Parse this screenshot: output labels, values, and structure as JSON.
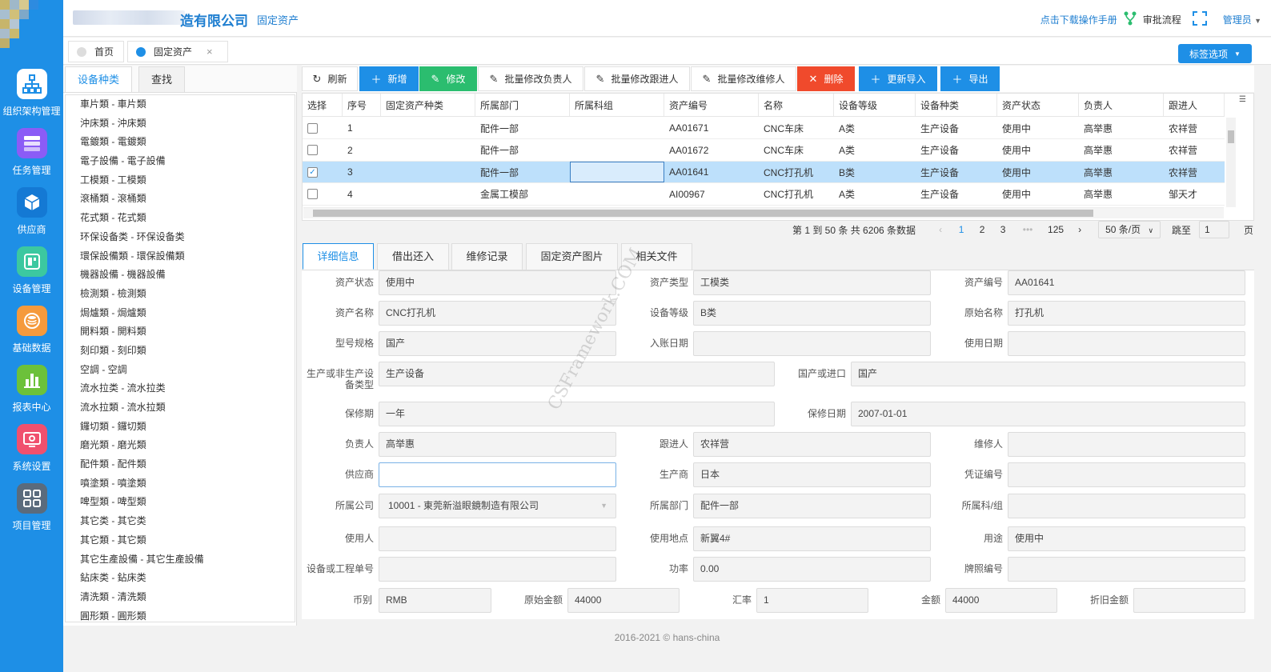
{
  "header": {
    "company_name": "造有限公司",
    "module": "固定资产",
    "manual_link": "点击下载操作手册",
    "approval_flow": "审批流程",
    "user": "管理员"
  },
  "sidebar": {
    "items": [
      {
        "label": "组织架构管理",
        "icon": "org-chart-icon",
        "color": "#1e8fe6"
      },
      {
        "label": "任务管理",
        "icon": "task-list-icon",
        "color": "#8b5cf6"
      },
      {
        "label": "供应商",
        "icon": "cube-icon",
        "color": "#1479d4"
      },
      {
        "label": "设备管理",
        "icon": "device-icon",
        "color": "#3cc8a0"
      },
      {
        "label": "基础数据",
        "icon": "database-icon",
        "color": "#f59a3c"
      },
      {
        "label": "报表中心",
        "icon": "bar-chart-icon",
        "color": "#6cc13a"
      },
      {
        "label": "系统设置",
        "icon": "settings-icon",
        "color": "#f0506e"
      },
      {
        "label": "项目管理",
        "icon": "grid-apps-icon",
        "color": "#5a6b7d"
      }
    ]
  },
  "page_tabs": [
    {
      "label": "首页"
    },
    {
      "label": "固定资产"
    }
  ],
  "tag_options": "标签选项",
  "category_panel": {
    "tab_category": "设备种类",
    "tab_search": "查找",
    "items": [
      "車片類 - 車片類",
      "沖床類 - 沖床類",
      "電鍍類 - 電鍍類",
      "電子設備 - 電子設備",
      "工模類 - 工模類",
      "滾桶類 - 滾桶類",
      "花式類 - 花式類",
      "环保设备类 - 环保设备类",
      "環保設備類 - 環保設備類",
      "機器設備 - 機器設備",
      "檢測類 - 檢測類",
      "焗爐類 - 焗爐類",
      "開料類 - 開料類",
      "刻印類 - 刻印類",
      "空調 - 空調",
      "流水拉类 - 流水拉类",
      "流水拉類 - 流水拉類",
      "鑼切類 - 鑼切類",
      "磨光類 - 磨光類",
      "配件類 - 配件類",
      "噴塗類 - 噴塗類",
      "啤型類 - 啤型類",
      "其它类 - 其它类",
      "其它類 - 其它類",
      "其它生產設備 - 其它生產設備",
      "鉆床类 - 鉆床类",
      "清洗類 - 清洗類",
      "圓形類 - 圓形類"
    ]
  },
  "toolbar": {
    "refresh": "刷新",
    "add": "新增",
    "edit": "修改",
    "batch_owner": "批量修改负责人",
    "batch_follower": "批量修改跟进人",
    "batch_maintainer": "批量修改维修人",
    "delete": "删除",
    "update_import": "更新导入",
    "export": "导出"
  },
  "grid": {
    "columns": [
      "选择",
      "序号",
      "固定资产种类",
      "所属部门",
      "所属科组",
      "资产编号",
      "名称",
      "设备等级",
      "设备种类",
      "资产状态",
      "负责人",
      "跟进人"
    ],
    "rows": [
      {
        "checked": false,
        "cells": [
          "1",
          "",
          "配件一部",
          "",
          "AA01671",
          "CNC车床",
          "A类",
          "生产设备",
          "使用中",
          "高举惠",
          "农祥营"
        ]
      },
      {
        "checked": false,
        "cells": [
          "2",
          "",
          "配件一部",
          "",
          "AA01672",
          "CNC车床",
          "A类",
          "生产设备",
          "使用中",
          "高举惠",
          "农祥营"
        ]
      },
      {
        "checked": true,
        "cells": [
          "3",
          "",
          "配件一部",
          "",
          "AA01641",
          "CNC打孔机",
          "B类",
          "生产设备",
          "使用中",
          "高举惠",
          "农祥营"
        ]
      },
      {
        "checked": false,
        "cells": [
          "4",
          "",
          "金属工模部",
          "",
          "AI00967",
          "CNC打孔机",
          "A类",
          "生产设备",
          "使用中",
          "高举惠",
          "邹天才"
        ]
      }
    ]
  },
  "pager": {
    "summary": "第 1 到 50 条 共 6206 条数据",
    "pages": [
      "1",
      "2",
      "3",
      "•••",
      "125"
    ],
    "page_size": "50 条/页",
    "goto_label": "跳至",
    "goto_value": "1",
    "page_unit": "页"
  },
  "detail_tabs": [
    "详细信息",
    "借出还入",
    "维修记录",
    "固定资产图片",
    "相关文件"
  ],
  "form": {
    "asset_status": {
      "label": "资产状态",
      "value": "使用中"
    },
    "asset_type": {
      "label": "资产类型",
      "value": "工模类"
    },
    "asset_no": {
      "label": "资产编号",
      "value": "AA01641"
    },
    "asset_name": {
      "label": "资产名称",
      "value": "CNC打孔机"
    },
    "equip_level": {
      "label": "设备等级",
      "value": "B类"
    },
    "orig_name": {
      "label": "原始名称",
      "value": "打孔机"
    },
    "model_spec": {
      "label": "型号规格",
      "value": "国产"
    },
    "entry_date": {
      "label": "入账日期",
      "value": ""
    },
    "use_date": {
      "label": "使用日期",
      "value": ""
    },
    "prod_type": {
      "label": "生产或非生产设备类型",
      "value": "生产设备"
    },
    "origin": {
      "label": "国产或进口",
      "value": "国产"
    },
    "warranty": {
      "label": "保修期",
      "value": "一年"
    },
    "warranty_date": {
      "label": "保修日期",
      "value": "2007-01-01"
    },
    "owner": {
      "label": "负责人",
      "value": "高举惠"
    },
    "follower": {
      "label": "跟进人",
      "value": "农祥营"
    },
    "maintainer": {
      "label": "维修人",
      "value": ""
    },
    "supplier": {
      "label": "供应商",
      "value": ""
    },
    "manufacturer": {
      "label": "生产商",
      "value": "日本"
    },
    "voucher_no": {
      "label": "凭证编号",
      "value": ""
    },
    "company": {
      "label": "所属公司",
      "value": "10001 - 東莞新溢眼鏡制造有限公司"
    },
    "department": {
      "label": "所属部门",
      "value": "配件一部"
    },
    "section": {
      "label": "所属科/组",
      "value": ""
    },
    "user": {
      "label": "使用人",
      "value": ""
    },
    "location": {
      "label": "使用地点",
      "value": "新翼4#"
    },
    "purpose": {
      "label": "用途",
      "value": "使用中"
    },
    "work_order": {
      "label": "设备或工程单号",
      "value": ""
    },
    "power": {
      "label": "功率",
      "value": "0.00"
    },
    "license_no": {
      "label": "牌照编号",
      "value": ""
    },
    "currency": {
      "label": "币别",
      "value": "RMB"
    },
    "orig_amount": {
      "label": "原始金额",
      "value": "44000"
    },
    "rate": {
      "label": "汇率",
      "value": "1"
    },
    "amount": {
      "label": "金额",
      "value": "44000"
    },
    "depreciation": {
      "label": "折旧金额",
      "value": ""
    }
  },
  "watermark": "CSFramework.COM",
  "footer": "2016-2021 © hans-china"
}
